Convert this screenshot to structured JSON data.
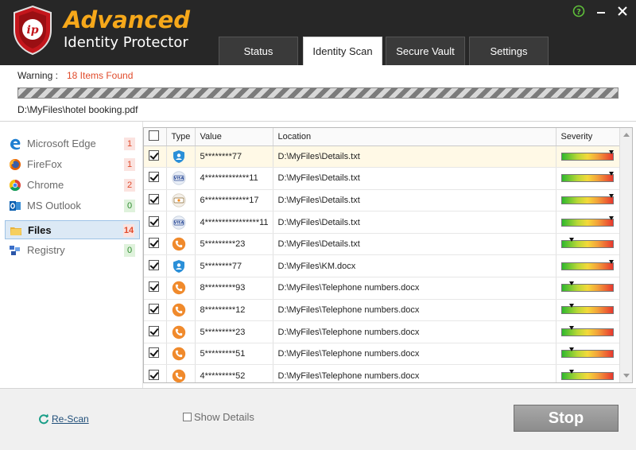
{
  "app": {
    "brand_top": "Advanced",
    "brand_bottom": "Identity Protector",
    "accent_color": "#f6a81a",
    "window_controls": [
      "help-icon",
      "minimize-icon",
      "close-icon"
    ]
  },
  "tabs": [
    {
      "label": "Status",
      "active": false
    },
    {
      "label": "Identity Scan",
      "active": true
    },
    {
      "label": "Secure Vault",
      "active": false
    },
    {
      "label": "Settings",
      "active": false
    }
  ],
  "scan": {
    "warning_label": "Warning :",
    "warning_value": "18 Items Found",
    "current_file": "D:\\MyFiles\\hotel booking.pdf"
  },
  "sidebar": {
    "items": [
      {
        "label": "Microsoft Edge",
        "count": "1",
        "icon": "edge-icon",
        "active": false,
        "count_color": "red"
      },
      {
        "label": "FireFox",
        "count": "1",
        "icon": "firefox-icon",
        "active": false,
        "count_color": "red"
      },
      {
        "label": "Chrome",
        "count": "2",
        "icon": "chrome-icon",
        "active": false,
        "count_color": "red"
      },
      {
        "label": "MS Outlook",
        "count": "0",
        "icon": "outlook-icon",
        "active": false,
        "count_color": "green"
      },
      {
        "label": "Files",
        "count": "14",
        "icon": "folder-icon",
        "active": true,
        "count_color": "red"
      },
      {
        "label": "Registry",
        "count": "0",
        "icon": "registry-icon",
        "active": false,
        "count_color": "green"
      }
    ]
  },
  "table": {
    "headers": {
      "type": "Type",
      "value": "Value",
      "location": "Location",
      "severity": "Severity"
    },
    "rows": [
      {
        "type": "shield-person-icon",
        "value": "5********77",
        "location": "D:\\MyFiles\\Details.txt",
        "severity": 0.97,
        "checked": true
      },
      {
        "type": "visa-card-icon",
        "value": "4*************11",
        "location": "D:\\MyFiles\\Details.txt",
        "severity": 0.97,
        "checked": true
      },
      {
        "type": "discover-card-icon",
        "value": "6*************17",
        "location": "D:\\MyFiles\\Details.txt",
        "severity": 0.97,
        "checked": true
      },
      {
        "type": "visa-card-icon",
        "value": "4****************11",
        "location": "D:\\MyFiles\\Details.txt",
        "severity": 0.97,
        "checked": true
      },
      {
        "type": "phone-icon",
        "value": "5*********23",
        "location": "D:\\MyFiles\\Details.txt",
        "severity": 0.2,
        "checked": true
      },
      {
        "type": "shield-person-icon",
        "value": "5********77",
        "location": "D:\\MyFiles\\KM.docx",
        "severity": 0.97,
        "checked": true
      },
      {
        "type": "phone-icon",
        "value": "8*********93",
        "location": "D:\\MyFiles\\Telephone numbers.docx",
        "severity": 0.2,
        "checked": true
      },
      {
        "type": "phone-icon",
        "value": "8*********12",
        "location": "D:\\MyFiles\\Telephone numbers.docx",
        "severity": 0.2,
        "checked": true
      },
      {
        "type": "phone-icon",
        "value": "5*********23",
        "location": "D:\\MyFiles\\Telephone numbers.docx",
        "severity": 0.2,
        "checked": true
      },
      {
        "type": "phone-icon",
        "value": "5*********51",
        "location": "D:\\MyFiles\\Telephone numbers.docx",
        "severity": 0.2,
        "checked": true
      },
      {
        "type": "phone-icon",
        "value": "4*********52",
        "location": "D:\\MyFiles\\Telephone numbers.docx",
        "severity": 0.2,
        "checked": true
      }
    ]
  },
  "footer": {
    "rescan": "Re-Scan",
    "show_details": "Show Details",
    "stop": "Stop"
  }
}
